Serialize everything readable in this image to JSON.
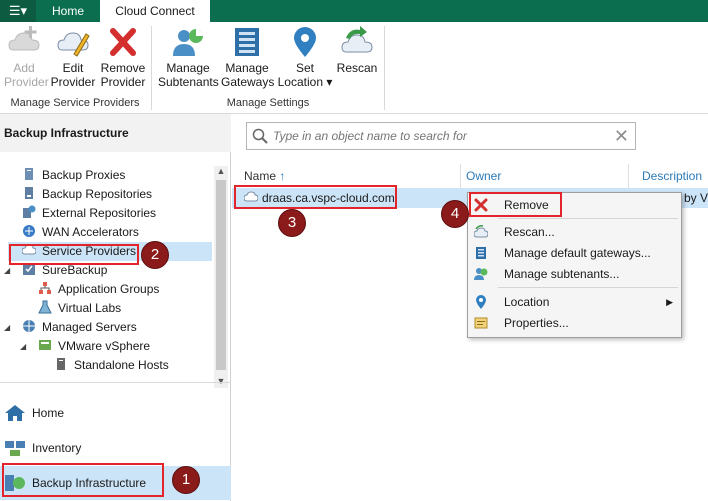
{
  "topbar": {
    "menu_icon": "hamburger-menu-icon",
    "tabs": [
      {
        "label": "Home",
        "active": false
      },
      {
        "label": "Cloud Connect",
        "active": true
      }
    ]
  },
  "ribbon": {
    "groups": [
      {
        "label": "Manage Service Providers",
        "buttons": [
          {
            "label": "Add\nProvider",
            "icon": "cloud-add-icon",
            "disabled": true
          },
          {
            "label": "Edit\nProvider",
            "icon": "cloud-edit-icon",
            "disabled": false
          },
          {
            "label": "Remove\nProvider",
            "icon": "remove-x-icon",
            "disabled": false
          }
        ]
      },
      {
        "label": "Manage Settings",
        "buttons": [
          {
            "label": "Manage\nSubtenants",
            "icon": "subtenants-icon"
          },
          {
            "label": "Manage\nGateways",
            "icon": "gateways-icon"
          },
          {
            "label": "Set\nLocation ▾",
            "icon": "location-pin-icon"
          },
          {
            "label": "Rescan",
            "icon": "rescan-cloud-icon"
          }
        ]
      }
    ]
  },
  "left_panel": {
    "header": "Backup Infrastructure",
    "tree": [
      {
        "label": "Backup Proxies",
        "icon": "proxy-icon"
      },
      {
        "label": "Backup Repositories",
        "icon": "repository-icon"
      },
      {
        "label": "External Repositories",
        "icon": "external-repository-icon"
      },
      {
        "label": "WAN Accelerators",
        "icon": "wan-accelerator-icon"
      },
      {
        "label": "Service Providers",
        "icon": "service-provider-cloud-icon",
        "selected": true
      },
      {
        "label": "SureBackup",
        "icon": "surebackup-icon",
        "expanded": true
      },
      {
        "label": "Application Groups",
        "icon": "application-groups-icon"
      },
      {
        "label": "Virtual Labs",
        "icon": "virtual-labs-icon"
      },
      {
        "label": "Managed Servers",
        "icon": "managed-servers-icon",
        "expanded": true
      },
      {
        "label": "VMware vSphere",
        "icon": "vsphere-icon",
        "expanded": true
      },
      {
        "label": "Standalone Hosts",
        "icon": "standalone-host-icon"
      }
    ],
    "nav": [
      {
        "label": "Home",
        "icon": "home-icon",
        "active": false
      },
      {
        "label": "Inventory",
        "icon": "inventory-icon",
        "active": false
      },
      {
        "label": "Backup Infrastructure",
        "icon": "backup-infrastructure-icon",
        "active": true
      }
    ]
  },
  "main": {
    "search_placeholder": "Type in an object name to search for",
    "columns": {
      "name": "Name",
      "owner": "Owner",
      "description": "Description"
    },
    "rows": [
      {
        "name": "draas.ca.vspc-cloud.com",
        "owner": "",
        "description_partial": "by V"
      }
    ]
  },
  "context_menu": {
    "items": [
      {
        "label": "Remove",
        "icon": "remove-x-icon"
      },
      {
        "label": "Rescan...",
        "icon": "rescan-icon"
      },
      {
        "label": "Manage default gateways...",
        "icon": "gateways-icon"
      },
      {
        "label": "Manage subtenants...",
        "icon": "subtenants-icon"
      },
      {
        "label": "Location",
        "icon": "location-pin-icon",
        "submenu": true
      },
      {
        "label": "Properties...",
        "icon": "properties-icon"
      }
    ]
  },
  "callouts": [
    "1",
    "2",
    "3",
    "4"
  ],
  "colors": {
    "topbar": "#0b6e4f",
    "selection": "#cce4f7",
    "highlight": "#e3242b",
    "badge": "#8b1a1a",
    "link": "#2a7ab8"
  }
}
